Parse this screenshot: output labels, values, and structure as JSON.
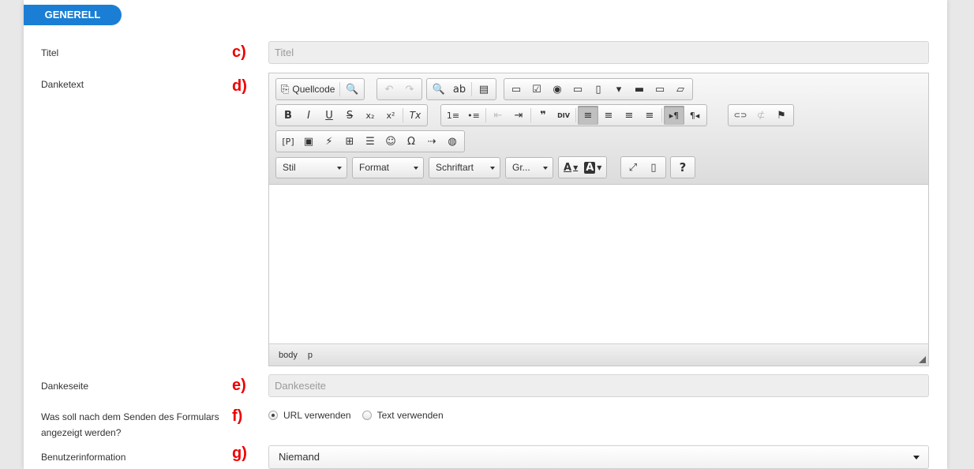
{
  "section": {
    "title": "GENERELL"
  },
  "fields": {
    "titel": {
      "label": "Titel",
      "marker": "c)",
      "placeholder": "Titel"
    },
    "danketext": {
      "label": "Danketext",
      "marker": "d)"
    },
    "dankeseite": {
      "label": "Dankeseite",
      "marker": "e)",
      "placeholder": "Dankeseite"
    },
    "after_submit": {
      "label_line1": "Was soll nach dem Senden des Formulars",
      "label_line2": "angezeigt werden?",
      "marker": "f)",
      "options": [
        "URL verwenden",
        "Text verwenden"
      ],
      "selected": "URL verwenden"
    },
    "benutzerinformation": {
      "label": "Benutzerinformation",
      "marker": "g)",
      "value": "Niemand"
    }
  },
  "editor": {
    "source_label": "Quellcode",
    "combos": {
      "style": "Stil",
      "format": "Format",
      "font": "Schriftart",
      "size": "Gr..."
    },
    "glyphs": {
      "preview": "🔍",
      "undo": "↶",
      "redo": "↷",
      "find": "🔍",
      "replace": "ab",
      "selectall": "▤",
      "form": "▭",
      "checkbox": "☑",
      "radio": "◉",
      "textfield": "▭",
      "textarea": "▯",
      "select": "▾",
      "button": "▬",
      "imagebutton": "▭",
      "hidden": "▱",
      "bold": "B",
      "italic": "I",
      "underline": "U",
      "strike": "S",
      "subscript": "x₂",
      "superscript": "x²",
      "removeformat": "Tx",
      "numlist": "1≡",
      "bullist": "•≡",
      "outdent": "⇤",
      "indent": "⇥",
      "blockquote": "❞",
      "div": "DIV",
      "alignleft": "≡",
      "aligncenter": "≡",
      "alignright": "≡",
      "justify": "≡",
      "ltr": "▸¶",
      "rtl": "¶◂",
      "link": "⊂⊃",
      "unlink": "⊄",
      "anchor": "⚑",
      "placeholder": "[P]",
      "image": "▣",
      "flash": "⚡",
      "table": "⊞",
      "hr": "☰",
      "smiley": "☺",
      "specialchar": "Ω",
      "pagebreak": "⇢",
      "iframe": "◍",
      "textcolor": "A",
      "bgcolor": "A",
      "maximize": "⤢",
      "showblocks": "▯",
      "about": "?"
    },
    "path": [
      "body",
      "p"
    ]
  },
  "colors": {
    "accent": "#1a7fd4",
    "marker": "#e00000"
  }
}
